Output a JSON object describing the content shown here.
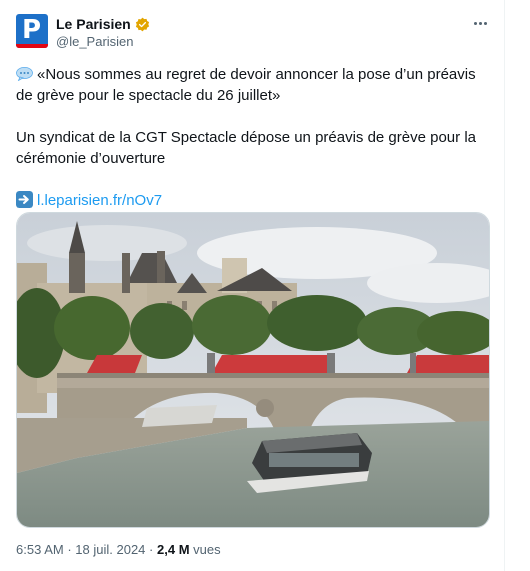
{
  "account": {
    "display_name": "Le Parisien",
    "handle": "@le_Parisien",
    "avatar_letter": "P",
    "verified_color": "#e2a500"
  },
  "tweet": {
    "quote_text": "«Nous sommes au regret de devoir annoncer la pose d’un préavis de grève pour le spectacle du 26 juillet»",
    "body_text": "Un syndicat de la CGT Spectacle dépose un préavis de grève pour la cérémonie d’ouverture",
    "link_text": "l.leparisien.fr/nOv7"
  },
  "meta": {
    "time": "6:53 AM",
    "separator": "·",
    "date": "18 juil. 2024",
    "views_count": "2,4 M",
    "views_label": "vues"
  },
  "colors": {
    "link": "#1d9bf0",
    "avatar_blue": "#1d70c8",
    "avatar_red": "#e30613"
  },
  "icons": {
    "speech": "speech-balloon-icon",
    "arrow": "right-arrow-icon",
    "more": "more-options-icon"
  }
}
